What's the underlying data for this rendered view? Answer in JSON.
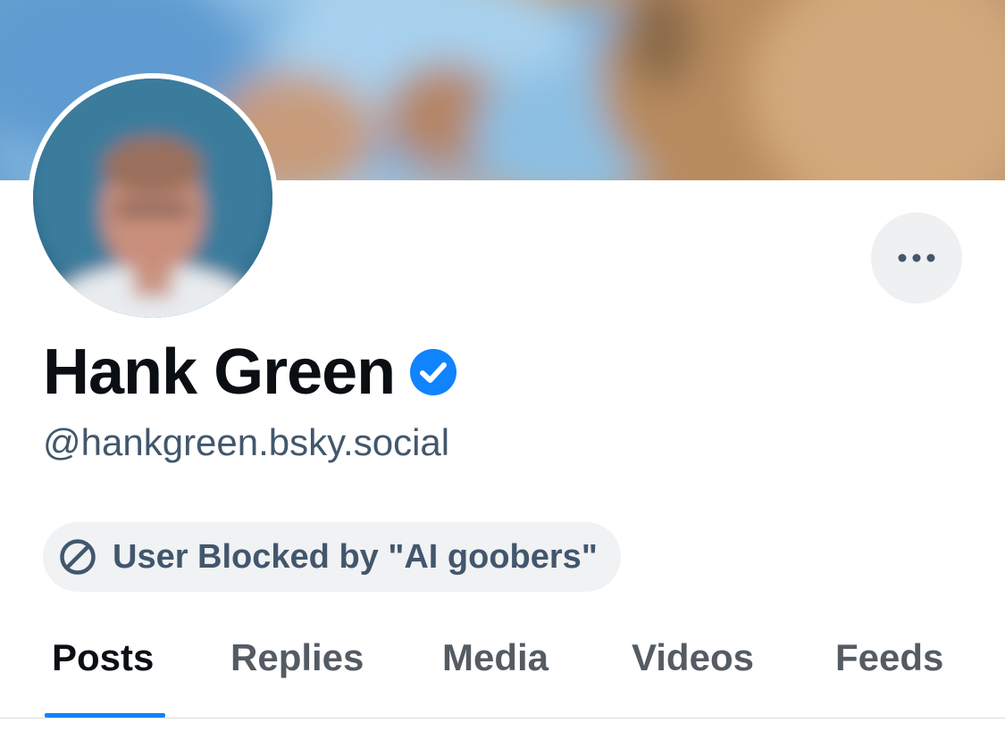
{
  "profile": {
    "display_name": "Hank Green",
    "handle": "@hankgreen.bsky.social",
    "verified": true,
    "blocked_notice": "User Blocked by \"AI goobers\""
  },
  "tabs": [
    {
      "label": "Posts",
      "active": true
    },
    {
      "label": "Replies",
      "active": false
    },
    {
      "label": "Media",
      "active": false
    },
    {
      "label": "Videos",
      "active": false
    },
    {
      "label": "Feeds",
      "active": false
    }
  ],
  "icons": {
    "verified": "verified-check-icon",
    "blocked": "block-icon",
    "more": "ellipsis-icon"
  },
  "colors": {
    "accent": "#1083fe",
    "text_primary": "#0b0f14",
    "text_secondary": "#42576c",
    "pill_bg": "#f0f2f4"
  }
}
